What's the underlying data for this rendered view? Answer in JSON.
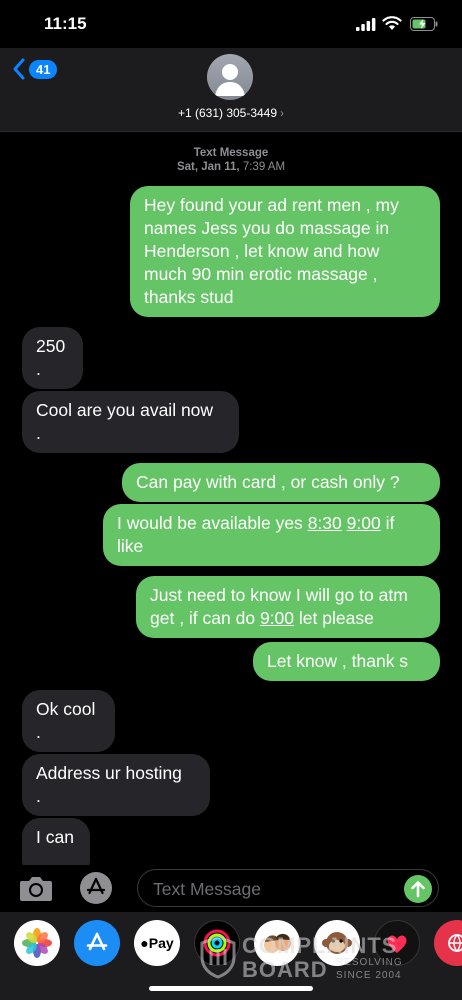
{
  "status": {
    "time": "11:15"
  },
  "header": {
    "back_count": "41",
    "contact": "+1 (631) 305-3449",
    "contact_chevron": "›"
  },
  "thread": {
    "service": "Text Message",
    "date": "Sat, Jan 11,",
    "time": "7:39 AM"
  },
  "messages": [
    {
      "dir": "out",
      "lines": [
        "Hey found your ad rent men , my",
        "names Jess you do massage in",
        "Henderson , let know and how",
        "much 90 min erotic massage   ,",
        "thanks stud"
      ]
    },
    {
      "dir": "in",
      "lines": [
        "250",
        "."
      ]
    },
    {
      "dir": "in",
      "lines": [
        "Cool are you avail now",
        "."
      ]
    },
    {
      "dir": "out",
      "lines": [
        "Can pay with card , or cash only ?"
      ]
    },
    {
      "dir": "out",
      "lines": [
        "I would be available yes",
        "8:30",
        "9:00",
        "if",
        "like"
      ]
    },
    {
      "dir": "out",
      "lines": [
        "Just need to know I will go to atm",
        "get , if can do",
        "9:00",
        "let please"
      ]
    },
    {
      "dir": "out",
      "lines": [
        "Let know , thank s"
      ]
    },
    {
      "dir": "in",
      "lines": [
        "Ok cool",
        "."
      ]
    },
    {
      "dir": "in",
      "lines": [
        "Address ur hosting",
        "."
      ]
    },
    {
      "dir": "in",
      "lines": [
        "I can"
      ]
    }
  ],
  "input": {
    "placeholder": "Text Message"
  },
  "apps": {
    "items": [
      "photos-icon",
      "app-store-icon",
      "apple-pay-icon",
      "activity-icon",
      "memoji-icon",
      "monkey-memoji-icon",
      "digital-touch-icon",
      "web-images-icon"
    ],
    "apple_pay_label": "Pay"
  },
  "watermark": {
    "line1": "COMPLAINTS",
    "line2": "BOARD",
    "small1": "RESOLVING",
    "small2": "SINCE 2004"
  },
  "colors": {
    "outgoing": "#65c466",
    "incoming": "#26252a",
    "accent": "#0a84ff"
  }
}
